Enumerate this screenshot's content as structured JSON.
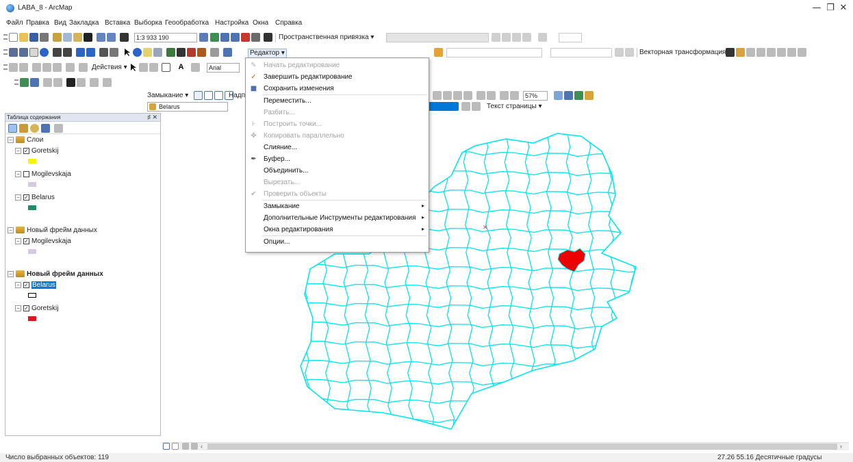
{
  "window": {
    "title": "LABA_8 - ArcMap",
    "minimize": "—",
    "maximize": "❐",
    "close": "✕"
  },
  "menubar": [
    "Файл",
    "Правка",
    "Вид",
    "Закладка",
    "Вставка",
    "Выборка",
    "Геообработка",
    "Настройка",
    "Окна",
    "Справка"
  ],
  "toolbar": {
    "scale_value": "1:3 933 190",
    "spatial_adjust_label": "Пространственная привязка ▾",
    "editor_label": "Редактор ▾",
    "vector_transform_label": "Векторная трансформация ▾",
    "actions_label": "Действия ▾",
    "font_name": "Arial",
    "snapping_label": "Замыкание ▾",
    "labels_label": "Надпи",
    "layer_select": "Belarus",
    "zoom_percent": "57%",
    "page_text_label": "Текст страницы ▾"
  },
  "toc": {
    "title": "Таблица содержания",
    "pin": "♯ ✕",
    "frames": [
      {
        "name": "Слои",
        "bold": false,
        "layers": [
          {
            "name": "Goretskij",
            "checked": true,
            "swatch": "#f5f500",
            "swatch_style": "fill"
          },
          {
            "name": "Mogilevskaja",
            "checked": false,
            "swatch": "#d7c8e6",
            "swatch_style": "fill"
          },
          {
            "name": "Belarus",
            "checked": true,
            "swatch": "#1f8a6c",
            "swatch_style": "fill"
          }
        ]
      },
      {
        "name": "Новый фрейм данных",
        "bold": false,
        "layers": [
          {
            "name": "Mogilevskaja",
            "checked": true,
            "swatch": "#d7c8e6",
            "swatch_style": "fill"
          }
        ]
      },
      {
        "name": "Новый фрейм данных",
        "bold": true,
        "layers": [
          {
            "name": "Belarus",
            "checked": true,
            "swatch": "#000000",
            "swatch_style": "hollow",
            "selected": true
          },
          {
            "name": "Goretskij",
            "checked": true,
            "swatch": "#e8141d",
            "swatch_style": "fill"
          }
        ]
      }
    ]
  },
  "editor_menu": {
    "items": [
      {
        "label": "Начать редактирование",
        "enabled": false,
        "icon": "✎",
        "icon_color": "#b0b0b0"
      },
      {
        "label": "Завершить редактирование",
        "enabled": true,
        "icon": "✓",
        "icon_color": "#c25a00"
      },
      {
        "label": "Сохранить изменения",
        "enabled": true,
        "icon": "■",
        "icon_color": "#4a6fb5"
      },
      {
        "label": "Переместить...",
        "enabled": true,
        "icon": "",
        "icon_color": "#000"
      },
      {
        "label": "Разбить...",
        "enabled": false,
        "icon": "",
        "icon_color": "#000"
      },
      {
        "label": "Построить точки...",
        "enabled": false,
        "icon": "⊦",
        "icon_color": "#b0b0b0"
      },
      {
        "label": "Копировать параллельно",
        "enabled": false,
        "icon": "✥",
        "icon_color": "#b0b0b0"
      },
      {
        "label": "Слияние...",
        "enabled": true,
        "icon": "",
        "icon_color": "#000"
      },
      {
        "label": "Буфер...",
        "enabled": true,
        "icon": "✒",
        "icon_color": "#444"
      },
      {
        "label": "Объединить...",
        "enabled": true,
        "icon": "",
        "icon_color": "#000"
      },
      {
        "label": "Вырезать...",
        "enabled": false,
        "icon": "",
        "icon_color": "#000"
      },
      {
        "label": "Проверить объекты",
        "enabled": false,
        "icon": "✔",
        "icon_color": "#b0b0b0"
      },
      {
        "label": "Замыкание",
        "enabled": true,
        "icon": "",
        "icon_color": "#000",
        "submenu": true
      },
      {
        "label": "Дополнительные Инструменты редактирования",
        "enabled": true,
        "icon": "",
        "icon_color": "#000",
        "submenu": true
      },
      {
        "label": "Окна редактирования",
        "enabled": true,
        "icon": "",
        "icon_color": "#000",
        "submenu": true
      },
      {
        "label": "Опции...",
        "enabled": true,
        "icon": "",
        "icon_color": "#000"
      }
    ]
  },
  "map": {
    "outline_color": "#00e5f0",
    "highlight_color": "#ee0000"
  },
  "status": {
    "selected_count": "Число выбранных объектов: 119",
    "coords": "27.26  55.16 Десятичные градусы"
  }
}
